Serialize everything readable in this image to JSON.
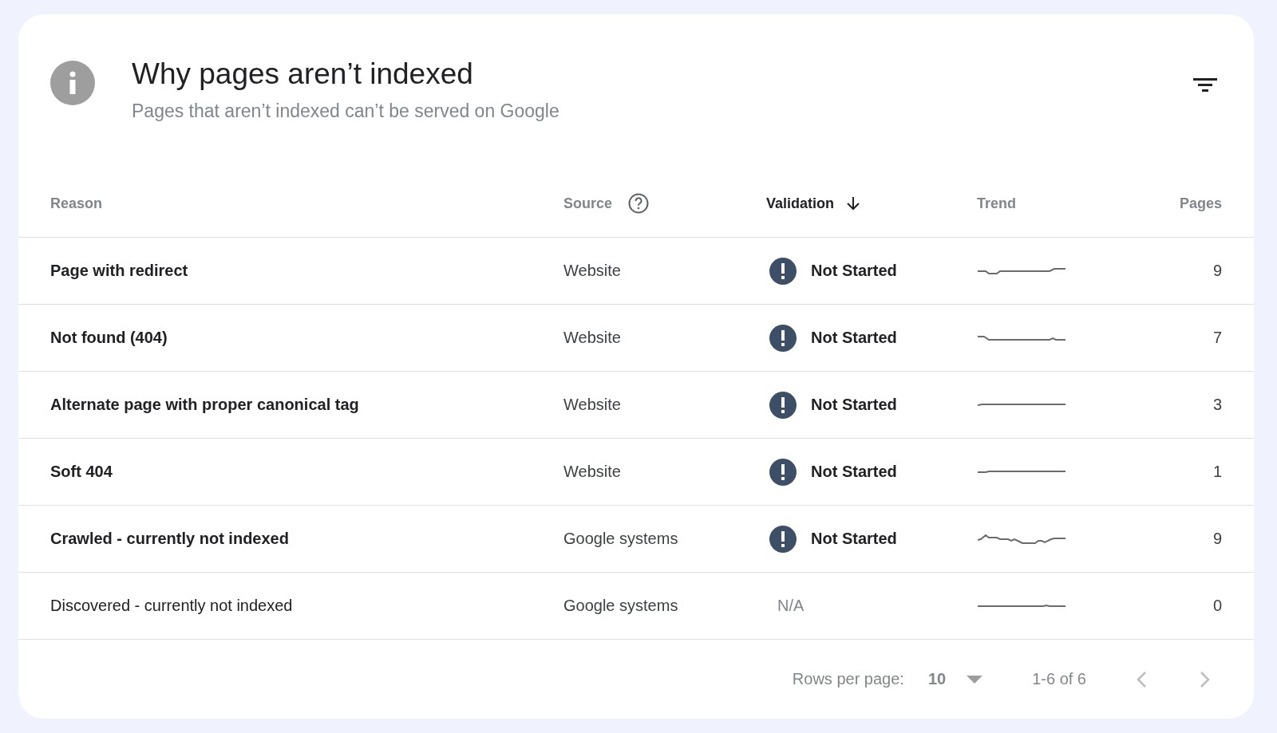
{
  "card": {
    "title": "Why pages aren’t indexed",
    "subtitle": "Pages that aren’t indexed can’t be served on Google"
  },
  "table": {
    "columns": [
      {
        "label": "Reason",
        "sorted": false,
        "kind": "text"
      },
      {
        "label": "Source",
        "sorted": false,
        "kind": "help"
      },
      {
        "label": "Validation",
        "sorted": true,
        "kind": "text"
      },
      {
        "label": "Trend",
        "sorted": false,
        "kind": "text"
      },
      {
        "label": "Pages",
        "sorted": false,
        "kind": "number"
      }
    ],
    "rows": [
      {
        "reason": "Page with redirect",
        "source": "Website",
        "validation": "Not Started",
        "kind": "alert",
        "pages": "9"
      },
      {
        "reason": "Not found (404)",
        "source": "Website",
        "validation": "Not Started",
        "kind": "alert",
        "pages": "7"
      },
      {
        "reason": "Alternate page with proper canonical tag",
        "source": "Website",
        "validation": "Not Started",
        "kind": "alert",
        "pages": "3"
      },
      {
        "reason": "Soft 404",
        "source": "Website",
        "validation": "Not Started",
        "kind": "alert",
        "pages": "1"
      },
      {
        "reason": "Crawled - currently not indexed",
        "source": "Google systems",
        "validation": "Not Started",
        "kind": "alert",
        "pages": "9"
      },
      {
        "reason": "Discovered - currently not indexed",
        "source": "Google systems",
        "validation": "N/A",
        "kind": "none",
        "pages": "0"
      }
    ]
  },
  "pagination": {
    "rows_label": "Rows per page:",
    "rows_value": "10",
    "range": "1-6 of 6"
  }
}
